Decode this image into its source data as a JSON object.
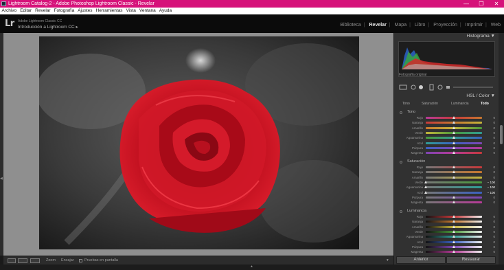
{
  "window": {
    "title": "Lightroom Catalog-2 - Adobe Photoshop Lightroom Classic - Revelar",
    "controls": [
      "—",
      "❐",
      "✕"
    ]
  },
  "menu": [
    "Archivo",
    "Editar",
    "Revelar",
    "Fotografía",
    "Ajustes",
    "Herramientas",
    "Vista",
    "Ventana",
    "Ayuda"
  ],
  "identity": {
    "logo": "Lr",
    "subtitle": "Adobe Lightroom Classic CC",
    "title": "Introducción a Lightroom CC ▸"
  },
  "modules": {
    "items": [
      "Biblioteca",
      "Revelar",
      "Mapa",
      "Libro",
      "Proyección",
      "Imprimir",
      "Web"
    ],
    "active": "Revelar"
  },
  "toolbar": {
    "zoom_label": "Zoom",
    "stamp_label": "Encajar",
    "proof_label": "Pruebas en pantalla"
  },
  "panel": {
    "histogram_title": "Histograma ▼",
    "original_label": "Fotografía original",
    "hsl_title": "HSL / Color ▼",
    "tabs": [
      "Tono",
      "Saturación",
      "Luminancia",
      "Todo"
    ],
    "active_tab": "Todo",
    "sections": [
      {
        "title": "Tono",
        "rows": [
          {
            "label": "Rojo",
            "value": "0",
            "pos": 0.5
          },
          {
            "label": "Naranja",
            "value": "0",
            "pos": 0.5
          },
          {
            "label": "Amarillo",
            "value": "0",
            "pos": 0.5
          },
          {
            "label": "Verde",
            "value": "0",
            "pos": 0.5
          },
          {
            "label": "Aguamarina",
            "value": "0",
            "pos": 0.5
          },
          {
            "label": "Azul",
            "value": "0",
            "pos": 0.5
          },
          {
            "label": "Púrpura",
            "value": "0",
            "pos": 0.5
          },
          {
            "label": "Magenta",
            "value": "0",
            "pos": 0.5
          }
        ]
      },
      {
        "title": "Saturación",
        "rows": [
          {
            "label": "Rojo",
            "value": "0",
            "pos": 0.5
          },
          {
            "label": "Naranja",
            "value": "0",
            "pos": 0.5
          },
          {
            "label": "Amarillo",
            "value": "0",
            "pos": 0.5
          },
          {
            "label": "Verde",
            "value": "− 100",
            "pos": 0.0
          },
          {
            "label": "Aguamarina",
            "value": "− 100",
            "pos": 0.0
          },
          {
            "label": "Azul",
            "value": "− 100",
            "pos": 0.0
          },
          {
            "label": "Púrpura",
            "value": "0",
            "pos": 0.5
          },
          {
            "label": "Magenta",
            "value": "0",
            "pos": 0.5
          }
        ]
      },
      {
        "title": "Luminancia",
        "rows": [
          {
            "label": "Rojo",
            "value": "0",
            "pos": 0.5
          },
          {
            "label": "Naranja",
            "value": "0",
            "pos": 0.5
          },
          {
            "label": "Amarillo",
            "value": "0",
            "pos": 0.5
          },
          {
            "label": "Verde",
            "value": "0",
            "pos": 0.5
          },
          {
            "label": "Aguamarina",
            "value": "0",
            "pos": 0.5
          },
          {
            "label": "Azul",
            "value": "0",
            "pos": 0.5
          },
          {
            "label": "Púrpura",
            "value": "0",
            "pos": 0.5
          },
          {
            "label": "Magenta",
            "value": "0",
            "pos": 0.5
          }
        ]
      }
    ],
    "buttons": {
      "previous": "Anterior",
      "reset": "Restaurar"
    }
  },
  "colors": {
    "titlebar": "#d6127a",
    "hue_rojo": "#c8393b",
    "hue_naranja": "#c8782f",
    "hue_amarillo": "#c7b53a",
    "hue_verde": "#4a9a3a",
    "hue_aguamarina": "#2f9d95",
    "hue_azul": "#3b62c3",
    "hue_purpura": "#7f45b5",
    "hue_magenta": "#b73a98"
  }
}
